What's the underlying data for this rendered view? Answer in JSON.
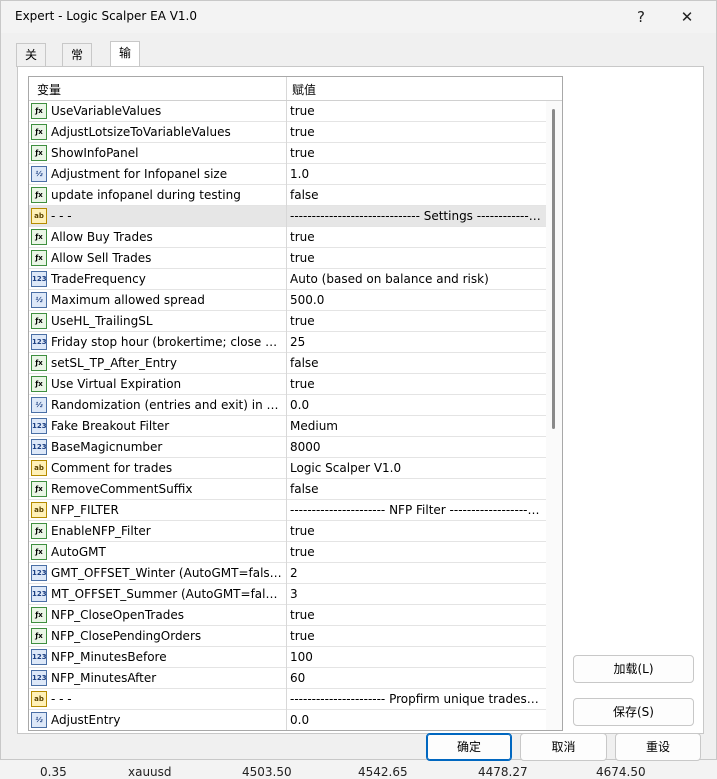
{
  "window": {
    "title": "Expert - Logic Scalper EA V1.0",
    "help_glyph": "?",
    "close_glyph": "✕"
  },
  "tabs": [
    {
      "label": "关于"
    },
    {
      "label": "常用"
    },
    {
      "label": "输入参数",
      "active": true
    }
  ],
  "grid": {
    "header": {
      "variable": "变量",
      "value": "赋值"
    },
    "rows": [
      {
        "type": "bool",
        "name": "UseVariableValues",
        "value": "true"
      },
      {
        "type": "bool",
        "name": "AdjustLotsizeToVariableValues",
        "value": "true"
      },
      {
        "type": "bool",
        "name": "ShowInfoPanel",
        "value": "true"
      },
      {
        "type": "dbl",
        "name": "Adjustment for Infopanel size",
        "value": "1.0"
      },
      {
        "type": "bool",
        "name": "update infopanel during testing",
        "value": "false"
      },
      {
        "type": "str",
        "name": "- - -",
        "value": "------------------------------ Settings --------------------",
        "sel": true
      },
      {
        "type": "bool",
        "name": "Allow Buy Trades",
        "value": "true"
      },
      {
        "type": "bool",
        "name": "Allow Sell Trades",
        "value": "true"
      },
      {
        "type": "num",
        "name": "TradeFrequency",
        "value": "Auto (based on balance and risk)"
      },
      {
        "type": "dbl",
        "name": "Maximum allowed spread",
        "value": "500.0"
      },
      {
        "type": "bool",
        "name": "UseHL_TrailingSL",
        "value": "true"
      },
      {
        "type": "num",
        "name": "Friday stop hour (brokertime; close all trades)",
        "value": "25"
      },
      {
        "type": "bool",
        "name": "setSL_TP_After_Entry",
        "value": "false"
      },
      {
        "type": "bool",
        "name": "Use Virtual Expiration",
        "value": "true"
      },
      {
        "type": "dbl",
        "name": "Randomization (entries and exit) in pips",
        "value": "0.0"
      },
      {
        "type": "num",
        "name": "Fake Breakout Filter",
        "value": "Medium"
      },
      {
        "type": "num",
        "name": "BaseMagicnumber",
        "value": "8000"
      },
      {
        "type": "str",
        "name": "Comment for trades",
        "value": "Logic Scalper V1.0"
      },
      {
        "type": "bool",
        "name": "RemoveCommentSuffix",
        "value": "false"
      },
      {
        "type": "str",
        "name": "NFP_FILTER",
        "value": "---------------------- NFP Filter ------------------------"
      },
      {
        "type": "bool",
        "name": "EnableNFP_Filter",
        "value": "true"
      },
      {
        "type": "bool",
        "name": "AutoGMT",
        "value": "true"
      },
      {
        "type": "num",
        "name": "GMT_OFFSET_Winter (AutoGMT=false only)",
        "value": "2"
      },
      {
        "type": "num",
        "name": "MT_OFFSET_Summer (AutoGMT=false only)",
        "value": "3"
      },
      {
        "type": "bool",
        "name": "NFP_CloseOpenTrades",
        "value": "true"
      },
      {
        "type": "bool",
        "name": "NFP_ClosePendingOrders",
        "value": "true"
      },
      {
        "type": "num",
        "name": "NFP_MinutesBefore",
        "value": "100"
      },
      {
        "type": "num",
        "name": "NFP_MinutesAfter",
        "value": "60"
      },
      {
        "type": "str",
        "name": "- - -",
        "value": "---------------------- Propfirm unique trades ------------"
      },
      {
        "type": "dbl",
        "name": "AdjustEntry",
        "value": "0.0"
      }
    ]
  },
  "icons": {
    "bool": "ƒx",
    "num": "123",
    "dbl": "½",
    "str": "ab"
  },
  "buttons": {
    "load": "加载(L)",
    "save": "保存(S)",
    "ok": "确定",
    "cancel": "取消",
    "reset": "重设"
  },
  "background_row": {
    "c1": "0.35",
    "c2": "xauusd",
    "c3": "4503.50",
    "c4": "4542.65",
    "c5": "4478.27",
    "c6": "4674.50"
  }
}
